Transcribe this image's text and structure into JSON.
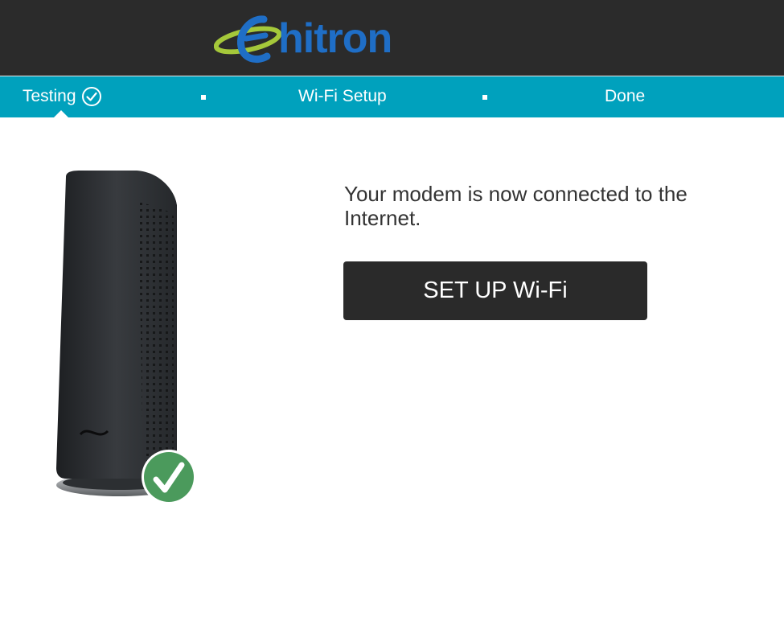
{
  "brand": {
    "name": "hitron",
    "colors": {
      "word": "#1f6ec6",
      "swoosh": "#a5c83a",
      "header_bg": "#2b2b2b"
    }
  },
  "steps": {
    "items": [
      {
        "label": "Testing",
        "status": "complete",
        "icon": "check-circle-icon"
      },
      {
        "label": "Wi-Fi Setup",
        "status": "pending"
      },
      {
        "label": "Done",
        "status": "pending"
      }
    ],
    "bar_color": "#00a1bd"
  },
  "main": {
    "message": "Your modem is now connected to the Internet.",
    "cta_label": "SET UP Wi-Fi",
    "device_image": "modem-illustration",
    "status_badge_icon": "green-checkmark-icon"
  }
}
